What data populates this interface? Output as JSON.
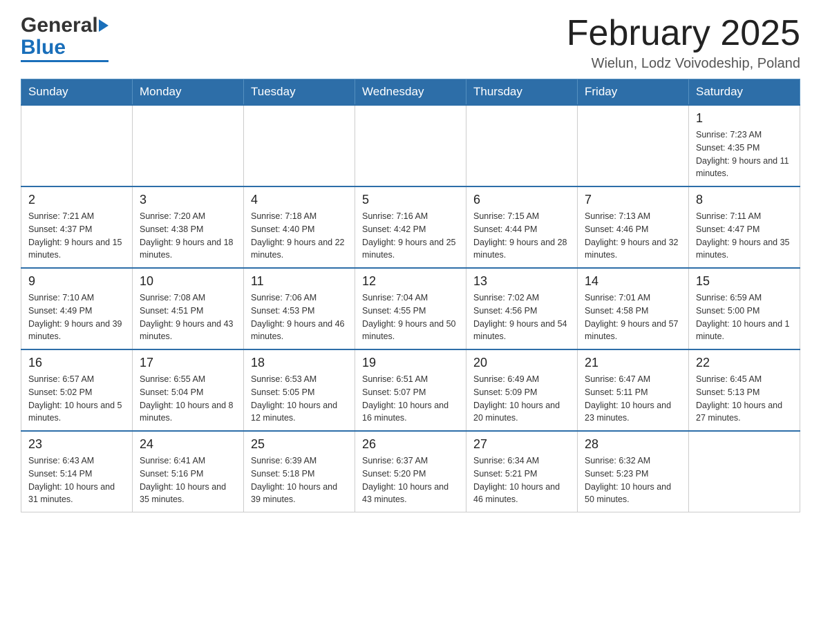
{
  "logo": {
    "text_general": "General",
    "text_blue": "Blue"
  },
  "header": {
    "title": "February 2025",
    "location": "Wielun, Lodz Voivodeship, Poland"
  },
  "days_of_week": [
    "Sunday",
    "Monday",
    "Tuesday",
    "Wednesday",
    "Thursday",
    "Friday",
    "Saturday"
  ],
  "weeks": [
    {
      "days": [
        {
          "num": "",
          "info": "",
          "empty": true
        },
        {
          "num": "",
          "info": "",
          "empty": true
        },
        {
          "num": "",
          "info": "",
          "empty": true
        },
        {
          "num": "",
          "info": "",
          "empty": true
        },
        {
          "num": "",
          "info": "",
          "empty": true
        },
        {
          "num": "",
          "info": "",
          "empty": true
        },
        {
          "num": "1",
          "info": "Sunrise: 7:23 AM\nSunset: 4:35 PM\nDaylight: 9 hours and 11 minutes.",
          "empty": false
        }
      ]
    },
    {
      "days": [
        {
          "num": "2",
          "info": "Sunrise: 7:21 AM\nSunset: 4:37 PM\nDaylight: 9 hours and 15 minutes.",
          "empty": false
        },
        {
          "num": "3",
          "info": "Sunrise: 7:20 AM\nSunset: 4:38 PM\nDaylight: 9 hours and 18 minutes.",
          "empty": false
        },
        {
          "num": "4",
          "info": "Sunrise: 7:18 AM\nSunset: 4:40 PM\nDaylight: 9 hours and 22 minutes.",
          "empty": false
        },
        {
          "num": "5",
          "info": "Sunrise: 7:16 AM\nSunset: 4:42 PM\nDaylight: 9 hours and 25 minutes.",
          "empty": false
        },
        {
          "num": "6",
          "info": "Sunrise: 7:15 AM\nSunset: 4:44 PM\nDaylight: 9 hours and 28 minutes.",
          "empty": false
        },
        {
          "num": "7",
          "info": "Sunrise: 7:13 AM\nSunset: 4:46 PM\nDaylight: 9 hours and 32 minutes.",
          "empty": false
        },
        {
          "num": "8",
          "info": "Sunrise: 7:11 AM\nSunset: 4:47 PM\nDaylight: 9 hours and 35 minutes.",
          "empty": false
        }
      ]
    },
    {
      "days": [
        {
          "num": "9",
          "info": "Sunrise: 7:10 AM\nSunset: 4:49 PM\nDaylight: 9 hours and 39 minutes.",
          "empty": false
        },
        {
          "num": "10",
          "info": "Sunrise: 7:08 AM\nSunset: 4:51 PM\nDaylight: 9 hours and 43 minutes.",
          "empty": false
        },
        {
          "num": "11",
          "info": "Sunrise: 7:06 AM\nSunset: 4:53 PM\nDaylight: 9 hours and 46 minutes.",
          "empty": false
        },
        {
          "num": "12",
          "info": "Sunrise: 7:04 AM\nSunset: 4:55 PM\nDaylight: 9 hours and 50 minutes.",
          "empty": false
        },
        {
          "num": "13",
          "info": "Sunrise: 7:02 AM\nSunset: 4:56 PM\nDaylight: 9 hours and 54 minutes.",
          "empty": false
        },
        {
          "num": "14",
          "info": "Sunrise: 7:01 AM\nSunset: 4:58 PM\nDaylight: 9 hours and 57 minutes.",
          "empty": false
        },
        {
          "num": "15",
          "info": "Sunrise: 6:59 AM\nSunset: 5:00 PM\nDaylight: 10 hours and 1 minute.",
          "empty": false
        }
      ]
    },
    {
      "days": [
        {
          "num": "16",
          "info": "Sunrise: 6:57 AM\nSunset: 5:02 PM\nDaylight: 10 hours and 5 minutes.",
          "empty": false
        },
        {
          "num": "17",
          "info": "Sunrise: 6:55 AM\nSunset: 5:04 PM\nDaylight: 10 hours and 8 minutes.",
          "empty": false
        },
        {
          "num": "18",
          "info": "Sunrise: 6:53 AM\nSunset: 5:05 PM\nDaylight: 10 hours and 12 minutes.",
          "empty": false
        },
        {
          "num": "19",
          "info": "Sunrise: 6:51 AM\nSunset: 5:07 PM\nDaylight: 10 hours and 16 minutes.",
          "empty": false
        },
        {
          "num": "20",
          "info": "Sunrise: 6:49 AM\nSunset: 5:09 PM\nDaylight: 10 hours and 20 minutes.",
          "empty": false
        },
        {
          "num": "21",
          "info": "Sunrise: 6:47 AM\nSunset: 5:11 PM\nDaylight: 10 hours and 23 minutes.",
          "empty": false
        },
        {
          "num": "22",
          "info": "Sunrise: 6:45 AM\nSunset: 5:13 PM\nDaylight: 10 hours and 27 minutes.",
          "empty": false
        }
      ]
    },
    {
      "days": [
        {
          "num": "23",
          "info": "Sunrise: 6:43 AM\nSunset: 5:14 PM\nDaylight: 10 hours and 31 minutes.",
          "empty": false
        },
        {
          "num": "24",
          "info": "Sunrise: 6:41 AM\nSunset: 5:16 PM\nDaylight: 10 hours and 35 minutes.",
          "empty": false
        },
        {
          "num": "25",
          "info": "Sunrise: 6:39 AM\nSunset: 5:18 PM\nDaylight: 10 hours and 39 minutes.",
          "empty": false
        },
        {
          "num": "26",
          "info": "Sunrise: 6:37 AM\nSunset: 5:20 PM\nDaylight: 10 hours and 43 minutes.",
          "empty": false
        },
        {
          "num": "27",
          "info": "Sunrise: 6:34 AM\nSunset: 5:21 PM\nDaylight: 10 hours and 46 minutes.",
          "empty": false
        },
        {
          "num": "28",
          "info": "Sunrise: 6:32 AM\nSunset: 5:23 PM\nDaylight: 10 hours and 50 minutes.",
          "empty": false
        },
        {
          "num": "",
          "info": "",
          "empty": true
        }
      ]
    }
  ]
}
